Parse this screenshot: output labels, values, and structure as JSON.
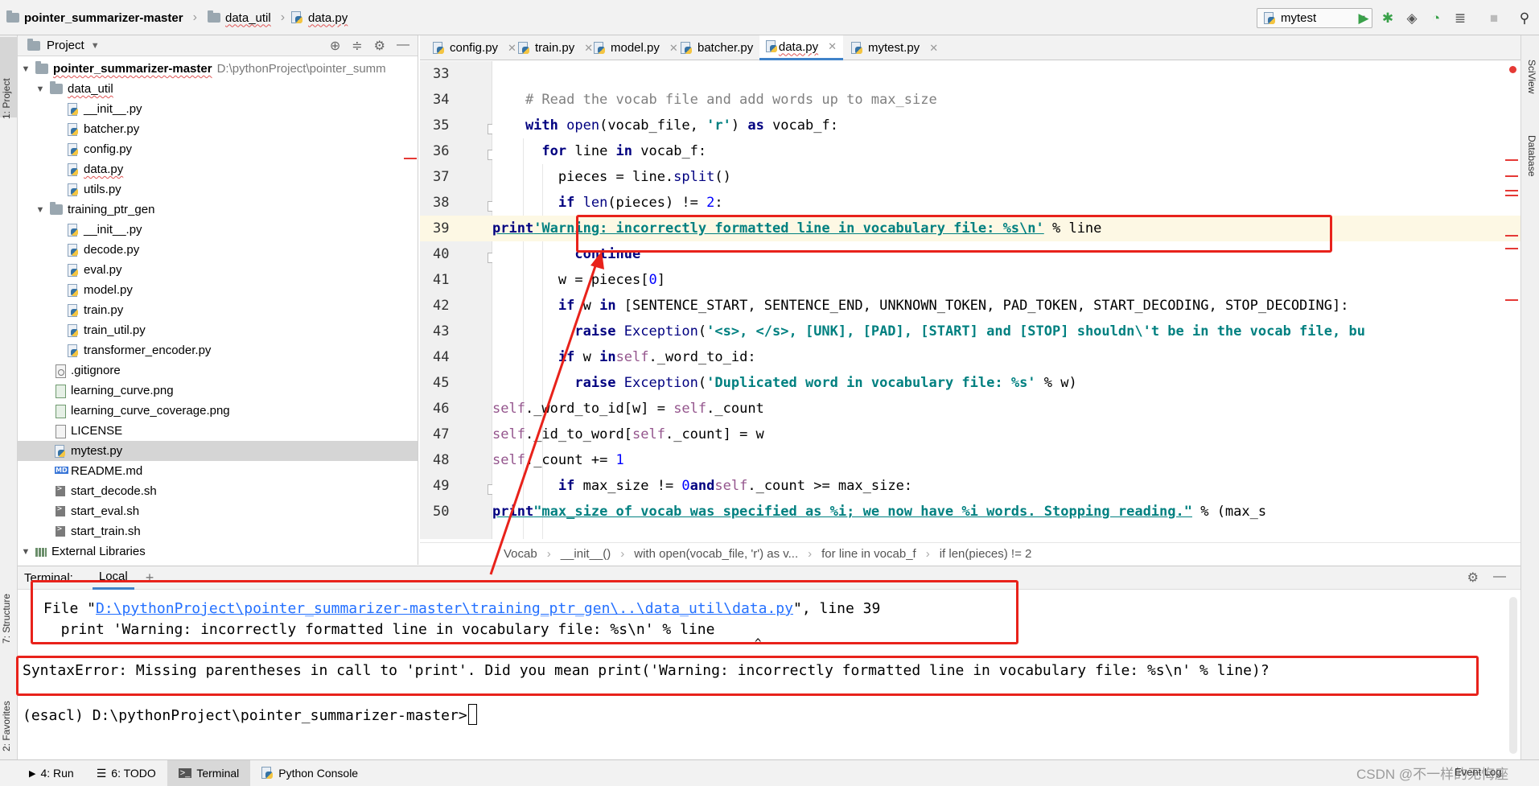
{
  "breadcrumb": {
    "project": "pointer_summarizer-master",
    "folder": "data_util",
    "file": "data.py"
  },
  "toolbar": {
    "run_config": "mytest",
    "run_icon": "play-icon",
    "debug_icon": "bug-icon",
    "coverage_icon": "shield-icon",
    "profile_icon": "profile-icon",
    "concurrency_icon": "concurrency-icon",
    "stop_icon": "stop-icon",
    "search_icon": "search-icon"
  },
  "side_tabs": {
    "project": "1: Project",
    "structure": "7: Structure",
    "favorites": "2: Favorites",
    "sciview": "SciView",
    "database": "Database"
  },
  "project_panel": {
    "title": "Project",
    "root_name": "pointer_summarizer-master",
    "root_path": "D:\\pythonProject\\pointer_summ",
    "data_util": {
      "name": "data_util",
      "files": [
        "__init__.py",
        "batcher.py",
        "config.py",
        "data.py",
        "utils.py"
      ]
    },
    "training_ptr_gen": {
      "name": "training_ptr_gen",
      "files": [
        "__init__.py",
        "decode.py",
        "eval.py",
        "model.py",
        "train.py",
        "train_util.py",
        "transformer_encoder.py"
      ]
    },
    "root_files": [
      ".gitignore",
      "learning_curve.png",
      "learning_curve_coverage.png",
      "LICENSE",
      "mytest.py",
      "README.md",
      "start_decode.sh",
      "start_eval.sh",
      "start_train.sh"
    ],
    "external": "External Libraries"
  },
  "editor_tabs": [
    "config.py",
    "train.py",
    "model.py",
    "batcher.py",
    "data.py",
    "mytest.py"
  ],
  "active_tab": "data.py",
  "editor_lines": [
    {
      "n": "33",
      "text": ""
    },
    {
      "n": "34",
      "text": "    # Read the vocab file and add words up to max_size"
    },
    {
      "n": "35",
      "text": "    with open(vocab_file, 'r') as vocab_f:"
    },
    {
      "n": "36",
      "text": "      for line in vocab_f:"
    },
    {
      "n": "37",
      "text": "        pieces = line.split()"
    },
    {
      "n": "38",
      "text": "        if len(pieces) != 2:"
    },
    {
      "n": "39",
      "text": "          print 'Warning: incorrectly formatted line in vocabulary file: %s\\n' % line"
    },
    {
      "n": "40",
      "text": "          continue"
    },
    {
      "n": "41",
      "text": "        w = pieces[0]"
    },
    {
      "n": "42",
      "text": "        if w in [SENTENCE_START, SENTENCE_END, UNKNOWN_TOKEN, PAD_TOKEN, START_DECODING, STOP_DECODING]:"
    },
    {
      "n": "43",
      "text": "          raise Exception('<s>, </s>, [UNK], [PAD], [START] and [STOP] shouldn\\'t be in the vocab file, bu"
    },
    {
      "n": "44",
      "text": "        if w in self._word_to_id:"
    },
    {
      "n": "45",
      "text": "          raise Exception('Duplicated word in vocabulary file: %s' % w)"
    },
    {
      "n": "46",
      "text": "        self._word_to_id[w] = self._count"
    },
    {
      "n": "47",
      "text": "        self._id_to_word[self._count] = w"
    },
    {
      "n": "48",
      "text": "        self._count += 1"
    },
    {
      "n": "49",
      "text": "        if max_size != 0 and self._count >= max_size:"
    },
    {
      "n": "50",
      "text": "          print \"max_size of vocab was specified as %i; we now have %i words. Stopping reading.\" % (max_s"
    }
  ],
  "editor_breadcrumb": [
    "Vocab",
    "__init__()",
    "with open(vocab_file, 'r') as v...",
    "for line in vocab_f",
    "if len(pieces) != 2"
  ],
  "terminal": {
    "title": "Terminal:",
    "tab": "Local",
    "file_prefix": "File \"",
    "file_link": "D:\\pythonProject\\pointer_summarizer-master\\training_ptr_gen\\..\\data_util\\data.py",
    "file_suffix": "\", line 39",
    "code_line": "  print 'Warning: incorrectly formatted line in vocabulary file: %s\\n' % line",
    "caret": "^",
    "error": "SyntaxError: Missing parentheses in call to 'print'. Did you mean print('Warning: incorrectly formatted line in vocabulary file: %s\\n' % line)?",
    "prompt": "(esacl) D:\\pythonProject\\pointer_summarizer-master>"
  },
  "bottom_tabs": [
    "4: Run",
    "6: TODO",
    "Terminal",
    "Python Console"
  ],
  "active_bottom_tab": "Terminal",
  "event_log": "Event Log",
  "watermark": "CSDN @不一样的无悔座",
  "colors": {
    "annotation_red": "#e8221b",
    "accent_blue": "#4083c9",
    "keyword": "#000080",
    "string": "#008080",
    "comment": "#808080",
    "number": "#0000ff"
  }
}
